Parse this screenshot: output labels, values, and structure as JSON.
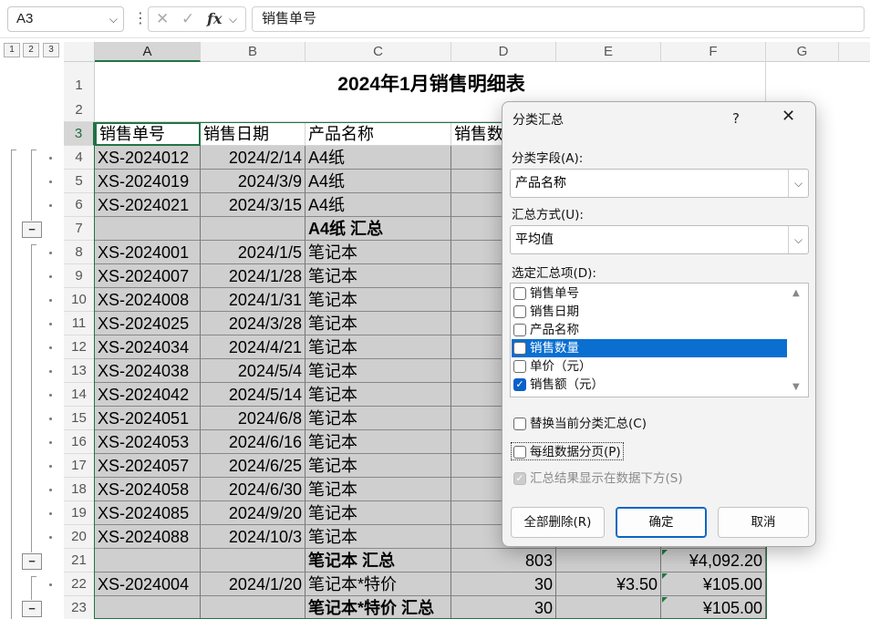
{
  "formula_bar": {
    "name_box": "A3",
    "fx": "fx",
    "formula": "销售单号"
  },
  "outline": {
    "levels": [
      "1",
      "2",
      "3"
    ],
    "collapse_symbol": "−"
  },
  "columns": [
    "A",
    "B",
    "C",
    "D",
    "E",
    "F",
    "G"
  ],
  "sheet": {
    "title": "2024年1月销售明细表",
    "header_row": [
      "销售单号",
      "销售日期",
      "产品名称",
      "销售数"
    ],
    "rows": [
      {
        "row": "4",
        "a": "XS-2024012",
        "b": "2024/2/14",
        "c": "A4纸"
      },
      {
        "row": "5",
        "a": "XS-2024019",
        "b": "2024/3/9",
        "c": "A4纸"
      },
      {
        "row": "6",
        "a": "XS-2024021",
        "b": "2024/3/15",
        "c": "A4纸"
      },
      {
        "row": "7",
        "a": "",
        "b": "",
        "c": "A4纸 汇总"
      },
      {
        "row": "8",
        "a": "XS-2024001",
        "b": "2024/1/5",
        "c": "笔记本"
      },
      {
        "row": "9",
        "a": "XS-2024007",
        "b": "2024/1/28",
        "c": "笔记本"
      },
      {
        "row": "10",
        "a": "XS-2024008",
        "b": "2024/1/31",
        "c": "笔记本"
      },
      {
        "row": "11",
        "a": "XS-2024025",
        "b": "2024/3/28",
        "c": "笔记本"
      },
      {
        "row": "12",
        "a": "XS-2024034",
        "b": "2024/4/21",
        "c": "笔记本"
      },
      {
        "row": "13",
        "a": "XS-2024038",
        "b": "2024/5/4",
        "c": "笔记本"
      },
      {
        "row": "14",
        "a": "XS-2024042",
        "b": "2024/5/14",
        "c": "笔记本"
      },
      {
        "row": "15",
        "a": "XS-2024051",
        "b": "2024/6/8",
        "c": "笔记本"
      },
      {
        "row": "16",
        "a": "XS-2024053",
        "b": "2024/6/16",
        "c": "笔记本"
      },
      {
        "row": "17",
        "a": "XS-2024057",
        "b": "2024/6/25",
        "c": "笔记本"
      },
      {
        "row": "18",
        "a": "XS-2024058",
        "b": "2024/6/30",
        "c": "笔记本"
      },
      {
        "row": "19",
        "a": "XS-2024085",
        "b": "2024/9/20",
        "c": "笔记本"
      },
      {
        "row": "20",
        "a": "XS-2024088",
        "b": "2024/10/3",
        "c": "笔记本"
      },
      {
        "row": "21",
        "a": "",
        "b": "",
        "c": "笔记本 汇总",
        "d": "803",
        "e": "",
        "f": "¥4,092.20"
      },
      {
        "row": "22",
        "a": "XS-2024004",
        "b": "2024/1/20",
        "c": "笔记本*特价",
        "d": "30",
        "e": "¥3.50",
        "f": "¥105.00"
      },
      {
        "row": "23",
        "a": "",
        "b": "",
        "c": "笔记本*特价 汇总",
        "d": "30",
        "e": "",
        "f": "¥105.00"
      }
    ],
    "title_row": "1",
    "blank_row": "2",
    "header_row_num": "3"
  },
  "dialog": {
    "title": "分类汇总",
    "help": "?",
    "close": "✕",
    "group_by_label": "分类字段(A):",
    "group_by_value": "产品名称",
    "function_label": "汇总方式(U):",
    "function_value": "平均值",
    "items_label": "选定汇总项(D):",
    "items": [
      {
        "label": "销售单号",
        "checked": false
      },
      {
        "label": "销售日期",
        "checked": false
      },
      {
        "label": "产品名称",
        "checked": false
      },
      {
        "label": "销售数量",
        "checked": false
      },
      {
        "label": "单价（元）",
        "checked": false
      },
      {
        "label": "销售额（元）",
        "checked": true
      }
    ],
    "replace_label": "替换当前分类汇总(C)",
    "pagebreak_label": "每组数据分页(P)",
    "below_label": "汇总结果显示在数据下方(S)",
    "remove_all": "全部删除(R)",
    "ok": "确定",
    "cancel": "取消",
    "checkmark": "✓",
    "dropdown_arrow": "⌵"
  }
}
